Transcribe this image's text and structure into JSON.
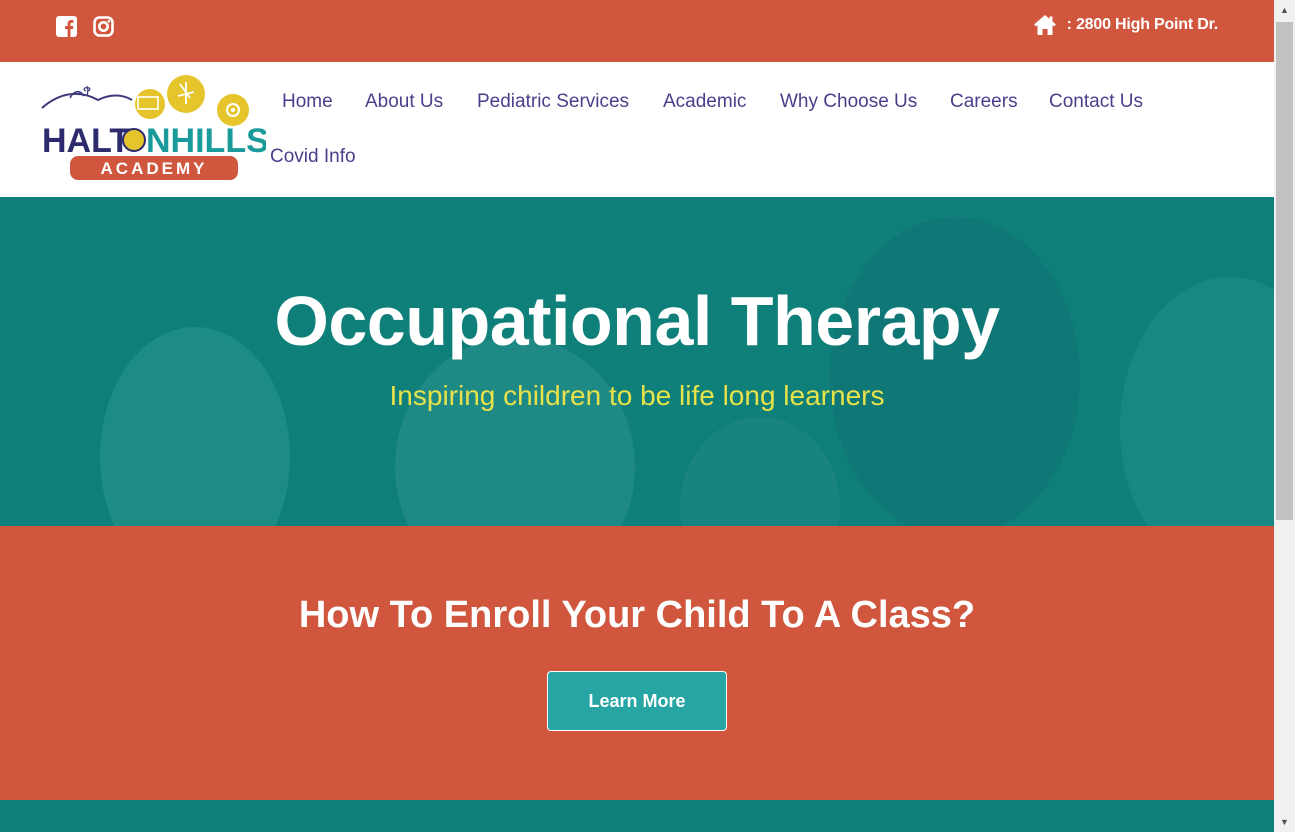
{
  "topbar": {
    "social": [
      {
        "icon": "facebook-icon"
      },
      {
        "icon": "instagram-icon"
      }
    ],
    "address_icon": "home-icon",
    "address": ": 2800 High Point Dr."
  },
  "header": {
    "logo": {
      "line1_left": "HALT",
      "line1_right": "NHILLS",
      "line2": "ACADEMY"
    },
    "nav": [
      {
        "label": "Home"
      },
      {
        "label": "About Us"
      },
      {
        "label": "Pediatric Services"
      },
      {
        "label": "Academic"
      },
      {
        "label": "Why Choose Us"
      },
      {
        "label": "Careers"
      },
      {
        "label": "Contact Us"
      },
      {
        "label": "Covid Info"
      }
    ]
  },
  "hero": {
    "title": "Occupational Therapy",
    "subtitle": "Inspiring children to be life long learners"
  },
  "enroll": {
    "title": "How To Enroll Your Child To A Class?",
    "button_label": "Learn More"
  },
  "colors": {
    "brand_orange": "#d0573e",
    "brand_teal": "#0f7f7a",
    "button_teal": "#27a5a4",
    "nav_text": "#4b3f8c",
    "accent_yellow": "#e7e24a"
  }
}
